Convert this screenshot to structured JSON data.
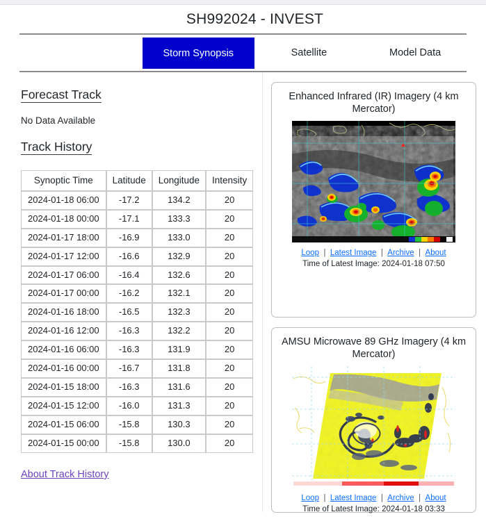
{
  "header": {
    "title": "SH992024 - INVEST"
  },
  "tabs": [
    {
      "label": "Storm Synopsis",
      "active": true
    },
    {
      "label": "Satellite",
      "active": false
    },
    {
      "label": "Model Data",
      "active": false
    }
  ],
  "left": {
    "forecast_heading": "Forecast Track",
    "forecast_status": "No Data Available",
    "history_heading": "Track History",
    "about_link": "About Track History",
    "table": {
      "columns": [
        "Synoptic Time",
        "Latitude",
        "Longitude",
        "Intensity"
      ],
      "rows": [
        [
          "2024-01-18 06:00",
          "-17.2",
          "134.2",
          "20"
        ],
        [
          "2024-01-18 00:00",
          "-17.1",
          "133.3",
          "20"
        ],
        [
          "2024-01-17 18:00",
          "-16.9",
          "133.0",
          "20"
        ],
        [
          "2024-01-17 12:00",
          "-16.6",
          "132.9",
          "20"
        ],
        [
          "2024-01-17 06:00",
          "-16.4",
          "132.6",
          "20"
        ],
        [
          "2024-01-17 00:00",
          "-16.2",
          "132.1",
          "20"
        ],
        [
          "2024-01-16 18:00",
          "-16.5",
          "132.3",
          "20"
        ],
        [
          "2024-01-16 12:00",
          "-16.3",
          "132.2",
          "20"
        ],
        [
          "2024-01-16 06:00",
          "-16.3",
          "131.9",
          "20"
        ],
        [
          "2024-01-16 00:00",
          "-16.7",
          "131.8",
          "20"
        ],
        [
          "2024-01-15 18:00",
          "-16.3",
          "131.6",
          "20"
        ],
        [
          "2024-01-15 12:00",
          "-16.0",
          "131.3",
          "20"
        ],
        [
          "2024-01-15 06:00",
          "-15.8",
          "130.3",
          "20"
        ],
        [
          "2024-01-15 00:00",
          "-15.8",
          "130.0",
          "20"
        ]
      ]
    }
  },
  "panels": {
    "ir": {
      "title": "Enhanced Infrared (IR) Imagery (4 km Mercator)",
      "links": [
        "Loop",
        "Latest Image",
        "Archive",
        "About"
      ],
      "separator": "|",
      "timestamp": "Time of Latest Image: 2024-01-18 07:50"
    },
    "microwave": {
      "title": "AMSU Microwave 89 GHz Imagery (4 km Mercator)",
      "links": [
        "Loop",
        "Latest Image",
        "Archive",
        "About"
      ],
      "separator": "|",
      "timestamp": "Time of Latest Image: 2024-01-18 03:33"
    }
  },
  "colors": {
    "active_tab_bg": "#0000cc",
    "link": "#0d6efd",
    "visited_link": "#6f42c1",
    "rule": "#8a8a8a"
  }
}
